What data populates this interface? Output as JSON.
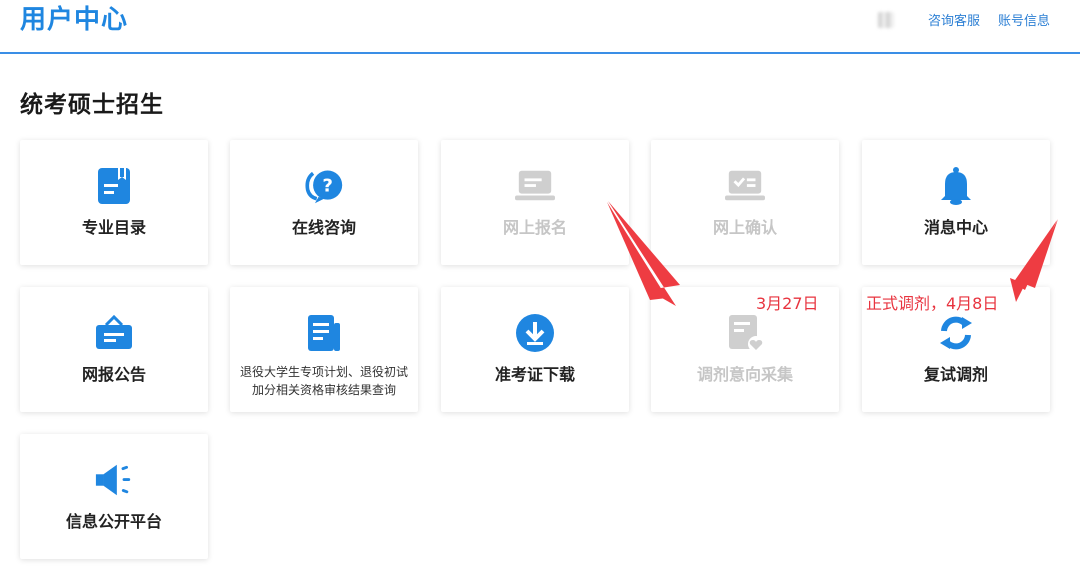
{
  "header": {
    "title": "用户中心",
    "links": [
      "咨询客服",
      "账号信息"
    ]
  },
  "section": {
    "title": "统考硕士招生"
  },
  "cards": [
    {
      "label": "专业目录",
      "icon": "book-icon",
      "enabled": true
    },
    {
      "label": "在线咨询",
      "icon": "chat-question-icon",
      "enabled": true
    },
    {
      "label": "网上报名",
      "icon": "laptop-icon",
      "enabled": false
    },
    {
      "label": "网上确认",
      "icon": "laptop-check-icon",
      "enabled": false
    },
    {
      "label": "消息中心",
      "icon": "bell-icon",
      "enabled": true
    },
    {
      "label": "网报公告",
      "icon": "briefcase-icon",
      "enabled": true
    },
    {
      "label": "",
      "sublabel": "退役大学生专项计划、退役初试加分相关资格审核结果查询",
      "icon": "document-icon",
      "enabled": true
    },
    {
      "label": "准考证下载",
      "icon": "download-icon",
      "enabled": true
    },
    {
      "label": "调剂意向采集",
      "icon": "form-heart-icon",
      "enabled": false
    },
    {
      "label": "复试调剂",
      "icon": "refresh-icon",
      "enabled": true
    },
    {
      "label": "信息公开平台",
      "icon": "megaphone-icon",
      "enabled": true
    }
  ],
  "annotations": {
    "date1": "3月27日",
    "date2": "正式调剂，4月8日"
  },
  "colors": {
    "primary": "#1f86e0",
    "disabled": "#c6c6c6",
    "annotation": "#e8343f"
  }
}
